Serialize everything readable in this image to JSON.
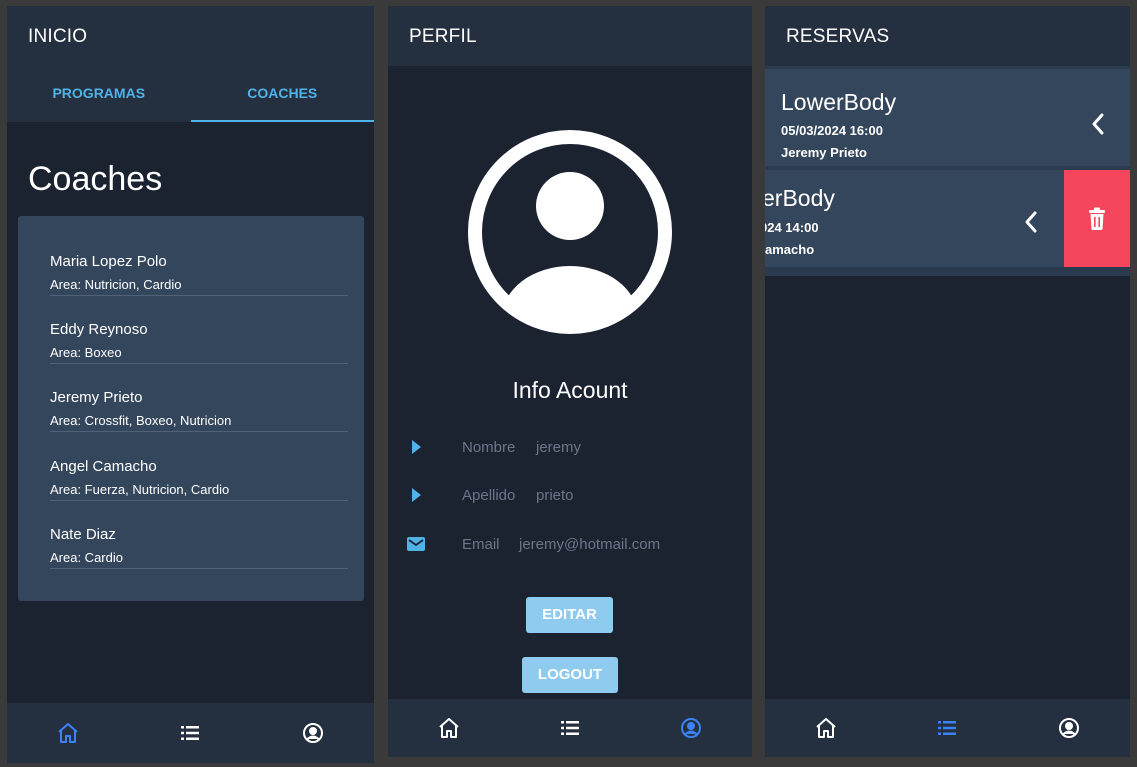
{
  "inicio": {
    "title": "INICIO",
    "tabs": [
      {
        "label": "PROGRAMAS"
      },
      {
        "label": "COACHES"
      }
    ],
    "heading": "Coaches",
    "coaches": [
      {
        "name": "Maria Lopez Polo",
        "area": "Area: Nutricion, Cardio"
      },
      {
        "name": "Eddy Reynoso",
        "area": "Area: Boxeo"
      },
      {
        "name": "Jeremy Prieto",
        "area": "Area: Crossfit, Boxeo, Nutricion"
      },
      {
        "name": "Angel Camacho",
        "area": "Area: Fuerza, Nutricion, Cardio"
      },
      {
        "name": "Nate Diaz",
        "area": "Area: Cardio"
      }
    ],
    "active_nav": "home"
  },
  "perfil": {
    "title": "PERFIL",
    "info_title": "Info Acount",
    "fields": {
      "nombre": {
        "label": "Nombre",
        "value": "jeremy"
      },
      "apellido": {
        "label": "Apellido",
        "value": "prieto"
      },
      "email": {
        "label": "Email",
        "value": "jeremy@hotmail.com"
      }
    },
    "edit_label": "EDITAR",
    "logout_label": "LOGOUT",
    "active_nav": "profile"
  },
  "reservas": {
    "title": "RESERVAS",
    "items": [
      {
        "title": "LowerBody",
        "date": "05/03/2024 16:00",
        "coach": "Jeremy Prieto"
      },
      {
        "title": "erBody",
        "date": "024 14:00",
        "coach": "amacho"
      }
    ],
    "active_nav": "list"
  },
  "icons": {
    "home": "home-icon",
    "list": "list-icon",
    "profile": "account-circle-icon",
    "chevron": "chevron-left-icon",
    "delete": "trash-icon",
    "arrow": "play-arrow-icon",
    "mail": "mail-icon"
  },
  "colors": {
    "background": "#1b2230",
    "bar": "#242f3f",
    "card": "#34465c",
    "accent": "#4fb3e8",
    "nav_active": "#3b82f6",
    "button": "#8ecbee",
    "delete": "#f5465e",
    "muted_text": "#6b7788"
  }
}
